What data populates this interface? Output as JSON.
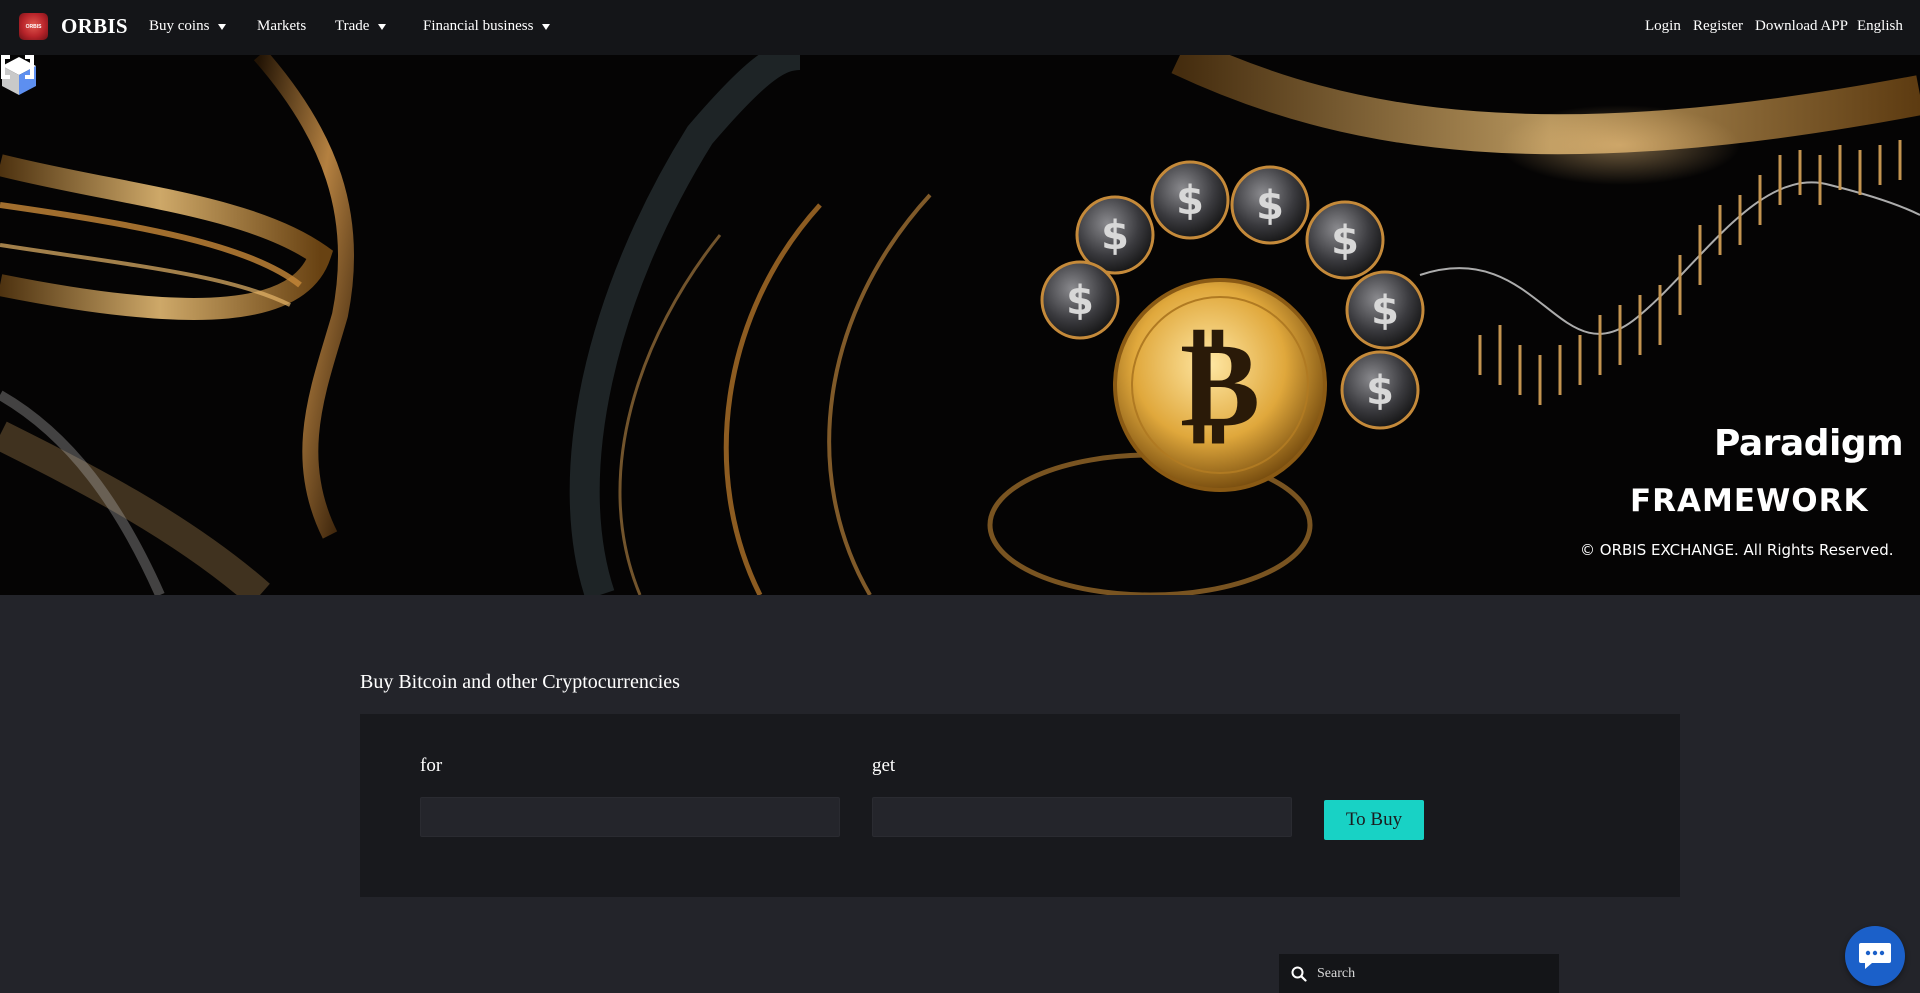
{
  "header": {
    "logo_text": "ORBIS",
    "brand": "ORBIS",
    "nav": {
      "buy_coins": "Buy coins",
      "markets": "Markets",
      "trade": "Trade",
      "financial": "Financial business"
    },
    "right": {
      "login": "Login",
      "register": "Register",
      "download": "Download APP",
      "language": "English"
    }
  },
  "hero": {
    "paradigm": "Paradigm",
    "framework": "FRAMEWORK",
    "rights": "© ORBIS EXCHANGE. All Rights Reserved."
  },
  "buy": {
    "title": "Buy Bitcoin and other Cryptocurrencies",
    "for_label": "for",
    "get_label": "get",
    "for_value": "",
    "get_value": "",
    "button": "To Buy"
  },
  "search": {
    "placeholder": "Search"
  },
  "colors": {
    "accent": "#18d2c5",
    "chat": "#1b60c9",
    "header_bg": "#141518",
    "page_bg": "#23242a"
  }
}
